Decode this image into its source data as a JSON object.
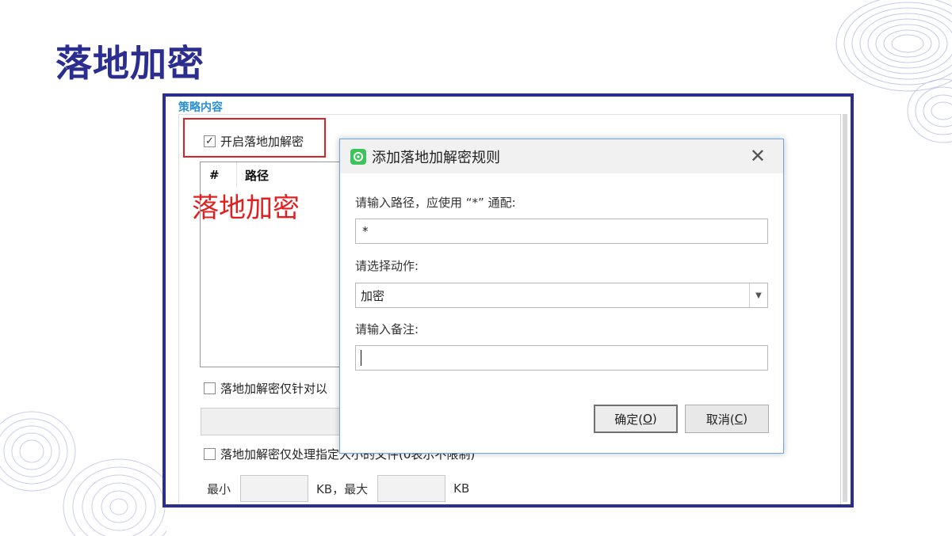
{
  "slide": {
    "title": "落地加密"
  },
  "panel": {
    "section_header": "策略内容",
    "enable_checkbox": {
      "label": "开启落地加解密",
      "checked": true
    },
    "table": {
      "columns": [
        "#",
        "路径"
      ]
    },
    "annotation": "落地加密",
    "option_checkbox_1": {
      "label": "落地加解密仅针对以",
      "checked": false
    },
    "option_checkbox_2": {
      "label": "落地加解密仅处理指定大小的文件(0表示不限制)",
      "checked": false
    },
    "size": {
      "min_label": "最小",
      "max_label": "KB，最大",
      "unit_label": "KB",
      "min_value": "",
      "max_value": ""
    }
  },
  "dialog": {
    "title": "添加落地加解密规则",
    "close_glyph": "✕",
    "path_label": "请输入路径，应使用 “*” 通配:",
    "path_value": "*",
    "action_label": "请选择动作:",
    "action_value": "加密",
    "remark_label": "请输入备注:",
    "remark_value": "",
    "ok": {
      "text": "确定(",
      "key": "O",
      "close": ")"
    },
    "cancel": {
      "text": "取消(",
      "key": "C",
      "close": ")"
    }
  },
  "icons": {
    "app": "app-icon",
    "dropdown": "chevron-down-icon",
    "close": "close-icon",
    "check": "checkmark-icon"
  },
  "colors": {
    "title": "#2b2d8f",
    "frame_border": "#2b2d8f",
    "highlight": "#e02020",
    "section_header": "#2a8fd4",
    "dialog_border": "#6aa8e0",
    "app_icon": "#3cc45a"
  }
}
